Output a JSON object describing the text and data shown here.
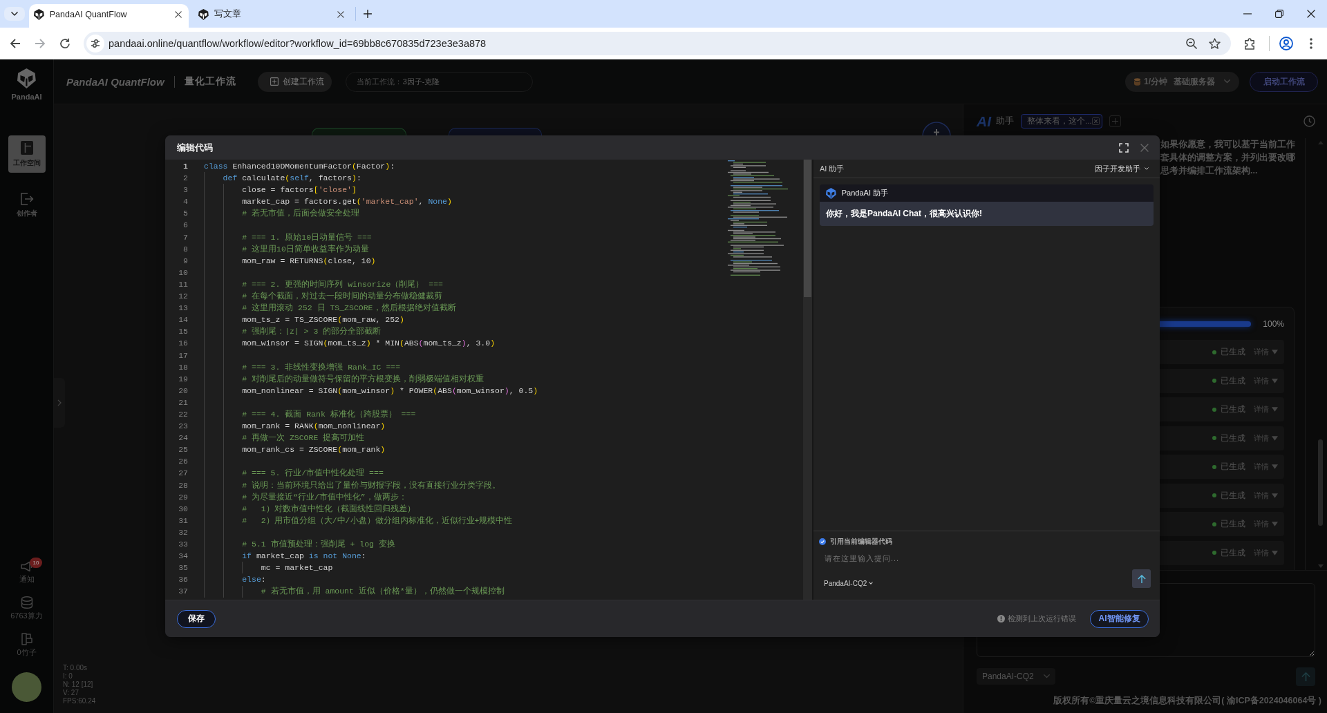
{
  "browser": {
    "tabs": [
      {
        "title": "PandaAI QuantFlow",
        "selected": true
      },
      {
        "title": "写文章",
        "selected": false
      }
    ],
    "url": "pandaai.online/quantflow/workflow/editor?workflow_id=69bb8c670835d723e3e3a878"
  },
  "sidebar": {
    "logo": "PandaAI",
    "nav": [
      {
        "label": "工作空间",
        "selected": true
      },
      {
        "label": "创作者",
        "selected": false
      }
    ],
    "tools": [
      {
        "label": "通知",
        "badge": "10"
      },
      {
        "label": "6763算力"
      },
      {
        "label": "0竹子"
      }
    ]
  },
  "header": {
    "brand": "PandaAI QuantFlow",
    "section": "量化工作流",
    "create_button": "创建工作流",
    "workflow_label": "当前工作流：",
    "workflow_name": "3因子-克隆",
    "rate": "1/分钟",
    "server": "基础服务器",
    "start_button": "启动工作流"
  },
  "canvas": {
    "stats": [
      "T: 0.00s",
      "I: 0",
      "N: 12 [12]",
      "V: 27",
      "FPS:60.24"
    ]
  },
  "assistant_panel": {
    "logo": "AI",
    "title": "助手",
    "tabs": [
      {
        "label": "整体来看，这个...",
        "selected": true
      }
    ],
    "message_lines": [
      "如果你愿意，我可以基于当前工作",
      "套具体的调整方案，并列出要改哪",
      "思考并编排工作流架构..."
    ],
    "progress": {
      "level": 1,
      "reading": "100%"
    },
    "steps": [
      {
        "status": "已生成",
        "action": "详情"
      },
      {
        "status": "已生成",
        "action": "详情"
      },
      {
        "status": "已生成",
        "action": "详情"
      },
      {
        "status": "已生成",
        "action": "详情"
      },
      {
        "status": "已生成",
        "action": "详情"
      },
      {
        "status": "已生成",
        "action": "详情"
      },
      {
        "status": "已生成",
        "action": "详情"
      },
      {
        "status": "已生成",
        "action": "详情"
      }
    ],
    "model": "PandaAI-CQ2"
  },
  "modal": {
    "title": "编辑代码",
    "code": {
      "lines": [
        {
          "number": "1",
          "active": true,
          "tokens": [
            {
              "kind": "keyword",
              "text": "class"
            },
            {
              "kind": "plain",
              "text": " Enhanced10DMomentumFactor"
            },
            {
              "kind": "bracket",
              "text": "("
            },
            {
              "kind": "plain",
              "text": "Factor"
            },
            {
              "kind": "bracket",
              "text": ")"
            },
            {
              "kind": "plain",
              "text": ":"
            }
          ],
          "children": [
            {
              "number": "2",
              "active": false,
              "tokens": [
                {
                  "kind": "keyword",
                  "text": "def"
                },
                {
                  "kind": "plain",
                  "text": " calculate"
                },
                {
                  "kind": "bracket",
                  "text": "("
                },
                {
                  "kind": "keyword",
                  "text": "self"
                },
                {
                  "kind": "plain",
                  "text": ", factors"
                },
                {
                  "kind": "bracket",
                  "text": ")"
                },
                {
                  "kind": "plain",
                  "text": ":"
                }
              ],
              "children": [
                {
                  "number": "3",
                  "active": false,
                  "tokens": [
                    {
                      "kind": "plain",
                      "text": "close = factors"
                    },
                    {
                      "kind": "bracket",
                      "text": "["
                    },
                    {
                      "kind": "string",
                      "text": "'close'"
                    },
                    {
                      "kind": "bracket",
                      "text": "]"
                    }
                  ]
                },
                {
                  "number": "4",
                  "active": false,
                  "tokens": [
                    {
                      "kind": "plain",
                      "text": "market_cap = factors.get"
                    },
                    {
                      "kind": "bracket",
                      "text": "("
                    },
                    {
                      "kind": "string",
                      "text": "'market_cap'"
                    },
                    {
                      "kind": "plain",
                      "text": ", "
                    },
                    {
                      "kind": "keyword",
                      "text": "None"
                    },
                    {
                      "kind": "bracket",
                      "text": ")"
                    }
                  ]
                },
                {
                  "number": "5",
                  "active": false,
                  "tokens": [
                    {
                      "kind": "comment",
                      "text": "# 若无市值，后面会做安全处理"
                    }
                  ]
                },
                {
                  "number": "6",
                  "active": false
                },
                {
                  "number": "7",
                  "active": false,
                  "tokens": [
                    {
                      "kind": "comment",
                      "text": "# === 1. 原始10日动量信号 ==="
                    }
                  ]
                },
                {
                  "number": "8",
                  "active": false,
                  "tokens": [
                    {
                      "kind": "comment",
                      "text": "# 这里用10日简单收益率作为动量"
                    }
                  ]
                },
                {
                  "number": "9",
                  "active": false,
                  "tokens": [
                    {
                      "kind": "plain",
                      "text": "mom_raw = RETURNS"
                    },
                    {
                      "kind": "bracket",
                      "text": "("
                    },
                    {
                      "kind": "plain",
                      "text": "close, 10"
                    },
                    {
                      "kind": "bracket",
                      "text": ")"
                    }
                  ]
                },
                {
                  "number": "10",
                  "active": false
                },
                {
                  "number": "11",
                  "active": false,
                  "tokens": [
                    {
                      "kind": "comment",
                      "text": "# === 2. 更强的时间序列 winsorize（削尾） ==="
                    }
                  ]
                },
                {
                  "number": "12",
                  "active": false,
                  "tokens": [
                    {
                      "kind": "comment",
                      "text": "# 在每个截面，对过去一段时间的动量分布做稳健裁剪"
                    }
                  ]
                },
                {
                  "number": "13",
                  "active": false,
                  "tokens": [
                    {
                      "kind": "comment",
                      "text": "# 这里用滚动 252 日 TS_ZSCORE，然后根据绝对值截断"
                    }
                  ]
                },
                {
                  "number": "14",
                  "active": false,
                  "tokens": [
                    {
                      "kind": "plain",
                      "text": "mom_ts_z = TS_ZSCORE"
                    },
                    {
                      "kind": "bracket",
                      "text": "("
                    },
                    {
                      "kind": "plain",
                      "text": "mom_raw, 252"
                    },
                    {
                      "kind": "bracket",
                      "text": ")"
                    }
                  ]
                },
                {
                  "number": "15",
                  "active": false,
                  "tokens": [
                    {
                      "kind": "comment",
                      "text": "# 强削尾：|z| > 3 的部分全部截断"
                    }
                  ]
                },
                {
                  "number": "16",
                  "active": false,
                  "tokens": [
                    {
                      "kind": "plain",
                      "text": "mom_winsor = SIGN"
                    },
                    {
                      "kind": "bracket",
                      "text": "("
                    },
                    {
                      "kind": "plain",
                      "text": "mom_ts_z"
                    },
                    {
                      "kind": "bracket",
                      "text": ")"
                    },
                    {
                      "kind": "plain",
                      "text": " * MIN"
                    },
                    {
                      "kind": "bracket",
                      "text": "("
                    },
                    {
                      "kind": "plain",
                      "text": "ABS"
                    },
                    {
                      "kind": "nested_bracket",
                      "text": "("
                    },
                    {
                      "kind": "plain",
                      "text": "mom_ts_z"
                    },
                    {
                      "kind": "nested_bracket",
                      "text": ")"
                    },
                    {
                      "kind": "plain",
                      "text": ", 3.0"
                    },
                    {
                      "kind": "bracket",
                      "text": ")"
                    }
                  ]
                },
                {
                  "number": "17",
                  "active": false
                },
                {
                  "number": "18",
                  "active": false,
                  "tokens": [
                    {
                      "kind": "comment",
                      "text": "# === 3. 非线性变换增强 Rank_IC ==="
                    }
                  ]
                },
                {
                  "number": "19",
                  "active": false,
                  "tokens": [
                    {
                      "kind": "comment",
                      "text": "# 对削尾后的动量做符号保留的平方根变换，削弱极端值相对权重"
                    }
                  ]
                },
                {
                  "number": "20",
                  "active": false,
                  "tokens": [
                    {
                      "kind": "plain",
                      "text": "mom_nonlinear = SIGN"
                    },
                    {
                      "kind": "bracket",
                      "text": "("
                    },
                    {
                      "kind": "plain",
                      "text": "mom_winsor"
                    },
                    {
                      "kind": "bracket",
                      "text": ")"
                    },
                    {
                      "kind": "plain",
                      "text": " * POWER"
                    },
                    {
                      "kind": "bracket",
                      "text": "("
                    },
                    {
                      "kind": "plain",
                      "text": "ABS"
                    },
                    {
                      "kind": "nested_bracket",
                      "text": "("
                    },
                    {
                      "kind": "plain",
                      "text": "mom_winsor"
                    },
                    {
                      "kind": "nested_bracket",
                      "text": ")"
                    },
                    {
                      "kind": "plain",
                      "text": ", 0.5"
                    },
                    {
                      "kind": "bracket",
                      "text": ")"
                    }
                  ]
                },
                {
                  "number": "21",
                  "active": false
                },
                {
                  "number": "22",
                  "active": false,
                  "tokens": [
                    {
                      "kind": "comment",
                      "text": "# === 4. 截面 Rank 标准化（跨股票） ==="
                    }
                  ]
                },
                {
                  "number": "23",
                  "active": false,
                  "tokens": [
                    {
                      "kind": "plain",
                      "text": "mom_rank = RANK"
                    },
                    {
                      "kind": "bracket",
                      "text": "("
                    },
                    {
                      "kind": "plain",
                      "text": "mom_nonlinear"
                    },
                    {
                      "kind": "bracket",
                      "text": ")"
                    }
                  ]
                },
                {
                  "number": "24",
                  "active": false,
                  "tokens": [
                    {
                      "kind": "comment",
                      "text": "# 再做一次 ZSCORE 提高可加性"
                    }
                  ]
                },
                {
                  "number": "25",
                  "active": false,
                  "tokens": [
                    {
                      "kind": "plain",
                      "text": "mom_rank_cs = ZSCORE"
                    },
                    {
                      "kind": "bracket",
                      "text": "("
                    },
                    {
                      "kind": "plain",
                      "text": "mom_rank"
                    },
                    {
                      "kind": "bracket",
                      "text": ")"
                    }
                  ]
                },
                {
                  "number": "26",
                  "active": false
                },
                {
                  "number": "27",
                  "active": false,
                  "tokens": [
                    {
                      "kind": "comment",
                      "text": "# === 5. 行业/市值中性化处理 ==="
                    }
                  ]
                },
                {
                  "number": "28",
                  "active": false,
                  "tokens": [
                    {
                      "kind": "comment",
                      "text": "# 说明：当前环境只给出了量价与财报字段，没有直接行业分类字段。"
                    }
                  ]
                },
                {
                  "number": "29",
                  "active": false,
                  "tokens": [
                    {
                      "kind": "comment",
                      "text": "# 为尽量接近“行业/市值中性化”，做两步："
                    }
                  ]
                },
                {
                  "number": "30",
                  "active": false,
                  "tokens": [
                    {
                      "kind": "comment",
                      "text": "#   1）对数市值中性化（截面线性回归残差）"
                    }
                  ]
                },
                {
                  "number": "31",
                  "active": false,
                  "tokens": [
                    {
                      "kind": "comment",
                      "text": "#   2）用市值分组（大/中/小盘）做分组内标准化，近似行业+规模中性"
                    }
                  ]
                },
                {
                  "number": "32",
                  "active": false
                },
                {
                  "number": "33",
                  "active": false,
                  "tokens": [
                    {
                      "kind": "comment",
                      "text": "# 5.1 市值预处理：强削尾 + log 变换"
                    }
                  ]
                },
                {
                  "number": "34",
                  "active": false,
                  "tokens": [
                    {
                      "kind": "keyword",
                      "text": "if"
                    },
                    {
                      "kind": "plain",
                      "text": " market_cap "
                    },
                    {
                      "kind": "keyword",
                      "text": "is not None"
                    },
                    {
                      "kind": "plain",
                      "text": ":"
                    }
                  ],
                  "children": [
                    {
                      "number": "35",
                      "active": false,
                      "tokens": [
                        {
                          "kind": "plain",
                          "text": "mc = market_cap"
                        }
                      ]
                    }
                  ]
                },
                {
                  "number": "36",
                  "active": false,
                  "tokens": [
                    {
                      "kind": "keyword",
                      "text": "else"
                    },
                    {
                      "kind": "plain",
                      "text": ":"
                    }
                  ],
                  "children": [
                    {
                      "number": "37",
                      "active": false,
                      "tokens": [
                        {
                          "kind": "comment",
                          "text": "# 若无市值，用 amount 近似（价格*量），仍然做一个规模控制"
                        }
                      ]
                    }
                  ]
                }
              ]
            }
          ]
        }
      ]
    },
    "assistant": {
      "title": "AI 助手",
      "mode": "因子开发助手",
      "messages": [
        {
          "sender": "PandaAI 助手",
          "text": "你好，我是PandaAI Chat，很高兴认识你!"
        }
      ],
      "quote_code": {
        "label": "引用当前编辑器代码",
        "checked": true
      },
      "placeholder": "请在这里输入提问...",
      "model": "PandaAI-CQ2"
    },
    "save_button": "保存",
    "error_notice": "检测到上次运行错误",
    "fix_button": "AI智能修复"
  },
  "footer": "版权所有©重庆量云之境信息科技有限公司( 渝ICP备2024046064号 )"
}
